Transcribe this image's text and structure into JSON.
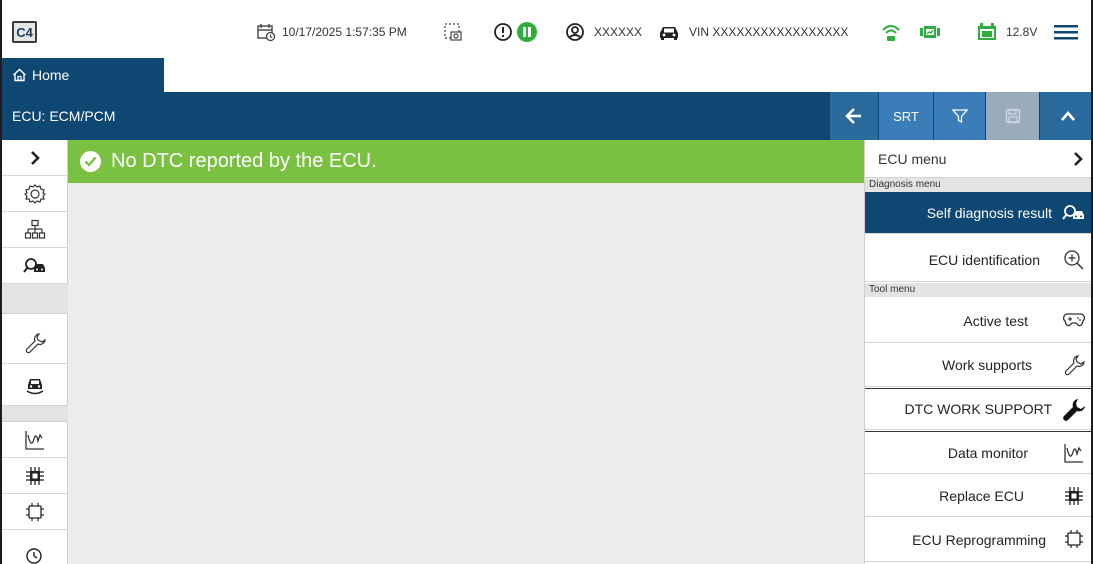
{
  "app": {
    "logo_text": "C4"
  },
  "status": {
    "datetime": "10/17/2025 1:57:35 PM",
    "user": "XXXXXX",
    "vin": "VIN XXXXXXXXXXXXXXXXX",
    "voltage": "12.8V",
    "colors": {
      "green": "#2fae3f",
      "navy": "#0e4771"
    }
  },
  "nav": {
    "home_label": "Home"
  },
  "ecu": {
    "title": "ECU: ECM/PCM",
    "srt_label": "SRT"
  },
  "banner": {
    "message": "No DTC reported by the ECU.",
    "color": "#7ac142"
  },
  "rail": {
    "icons": [
      "chevron-right-icon",
      "settings-icon",
      "tree-icon",
      "self-diagnosis-icon",
      "wrench-icon",
      "car-rotate-icon",
      "waveform-icon",
      "chip-icon",
      "chip-outline-icon",
      "clock-icon"
    ]
  },
  "menu": {
    "ecu_menu_label": "ECU menu",
    "diagnosis_section": "Diagnosis menu",
    "tool_section": "Tool menu",
    "items": [
      {
        "label": "Self diagnosis result",
        "icon": "self-diagnosis-icon",
        "active": true
      },
      {
        "label": "ECU identification",
        "icon": "zoom-in-icon",
        "active": false
      },
      {
        "label": "Active test",
        "icon": "gamepad-icon",
        "active": false
      },
      {
        "label": "Work supports",
        "icon": "wrench-outline-icon",
        "active": false
      },
      {
        "label": "DTC WORK SUPPORT",
        "icon": "wrench-solid-icon",
        "active": false
      },
      {
        "label": "Data monitor",
        "icon": "waveform-icon",
        "active": false
      },
      {
        "label": "Replace ECU",
        "icon": "chip-icon",
        "active": false
      },
      {
        "label": "ECU Reprogramming",
        "icon": "chip-outline-icon",
        "active": false
      }
    ]
  }
}
